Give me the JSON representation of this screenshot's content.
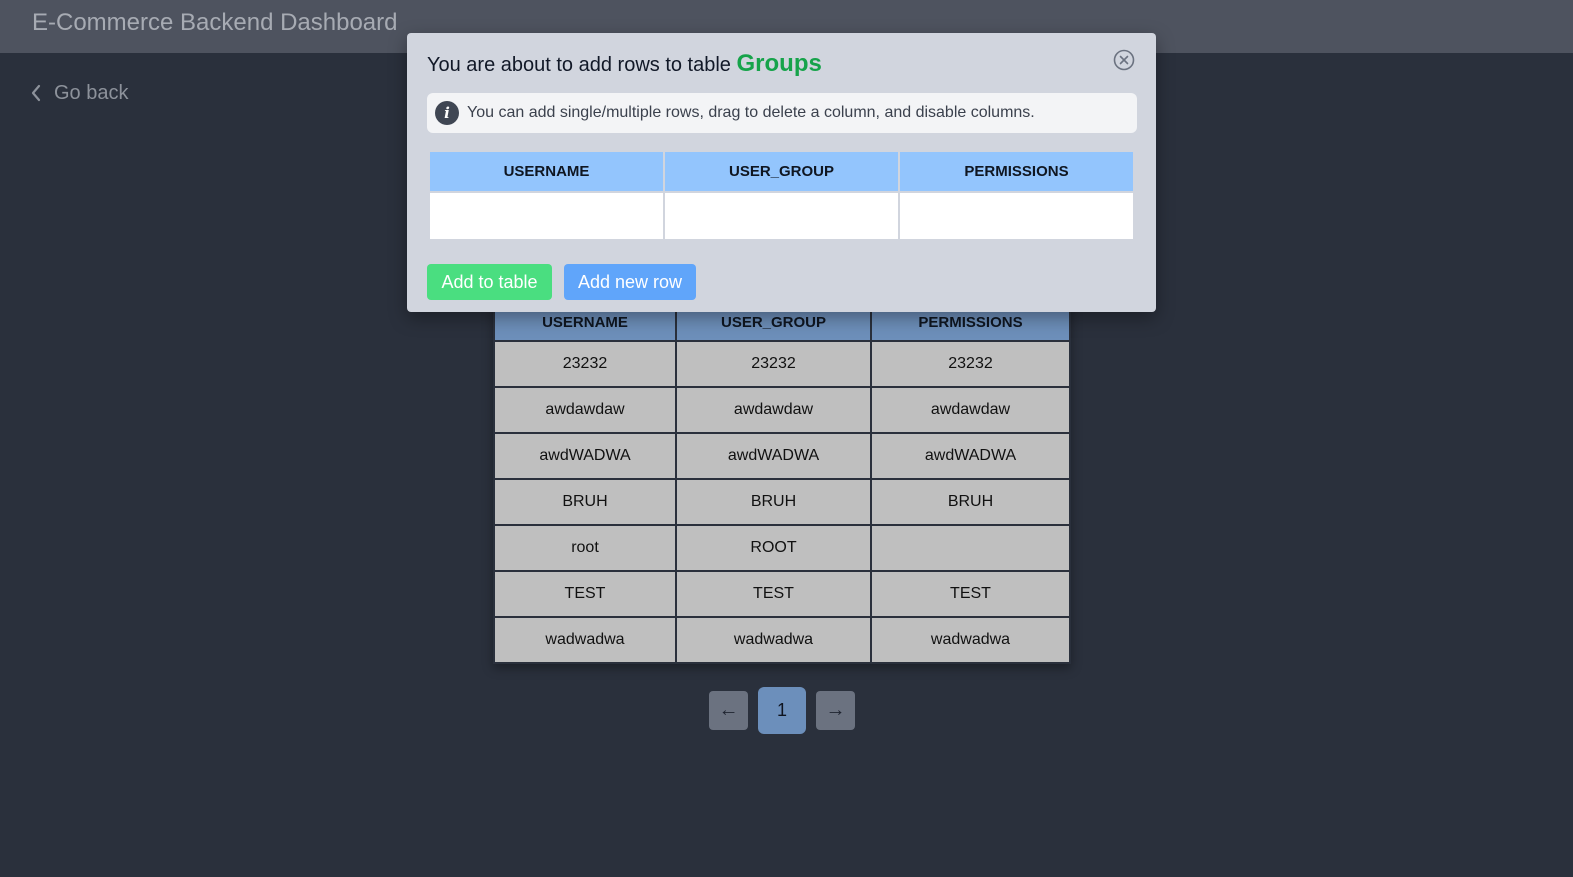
{
  "app": {
    "title": "E-Commerce Backend Dashboard"
  },
  "nav": {
    "go_back": "Go back"
  },
  "table": {
    "columns": [
      "USERNAME",
      "USER_GROUP",
      "PERMISSIONS"
    ],
    "rows": [
      [
        "23232",
        "23232",
        "23232"
      ],
      [
        "awdawdaw",
        "awdawdaw",
        "awdawdaw"
      ],
      [
        "awdWADWA",
        "awdWADWA",
        "awdWADWA"
      ],
      [
        "BRUH",
        "BRUH",
        "BRUH"
      ],
      [
        "root",
        "ROOT",
        ""
      ],
      [
        "TEST",
        "TEST",
        "TEST"
      ],
      [
        "wadwadwa",
        "wadwadwa",
        "wadwadwa"
      ]
    ]
  },
  "pagination": {
    "prev": "←",
    "current": "1",
    "next": "→"
  },
  "modal": {
    "title_prefix": "You are about to add rows to table",
    "table_name": "Groups",
    "info_text": "You can add single/multiple rows, drag to delete a column, and disable columns.",
    "columns": [
      "USERNAME",
      "USER_GROUP",
      "PERMISSIONS"
    ],
    "new_row": [
      "",
      "",
      ""
    ],
    "add_to_table": "Add to table",
    "add_new_row": "Add new row"
  },
  "colors": {
    "background": "#2a303c",
    "topbar": "#4e535f",
    "table_header": "#6d8fba",
    "table_cell": "#bfbfbf",
    "modal_bg": "#d1d5de",
    "table_name": "#16a34a",
    "add_button": "#4ade80",
    "new_row_button": "#60a5fa",
    "input_header": "#93c5fd"
  },
  "icons": {
    "back": "chevron-left-icon",
    "info": "info-icon",
    "close": "close-circle-icon"
  }
}
